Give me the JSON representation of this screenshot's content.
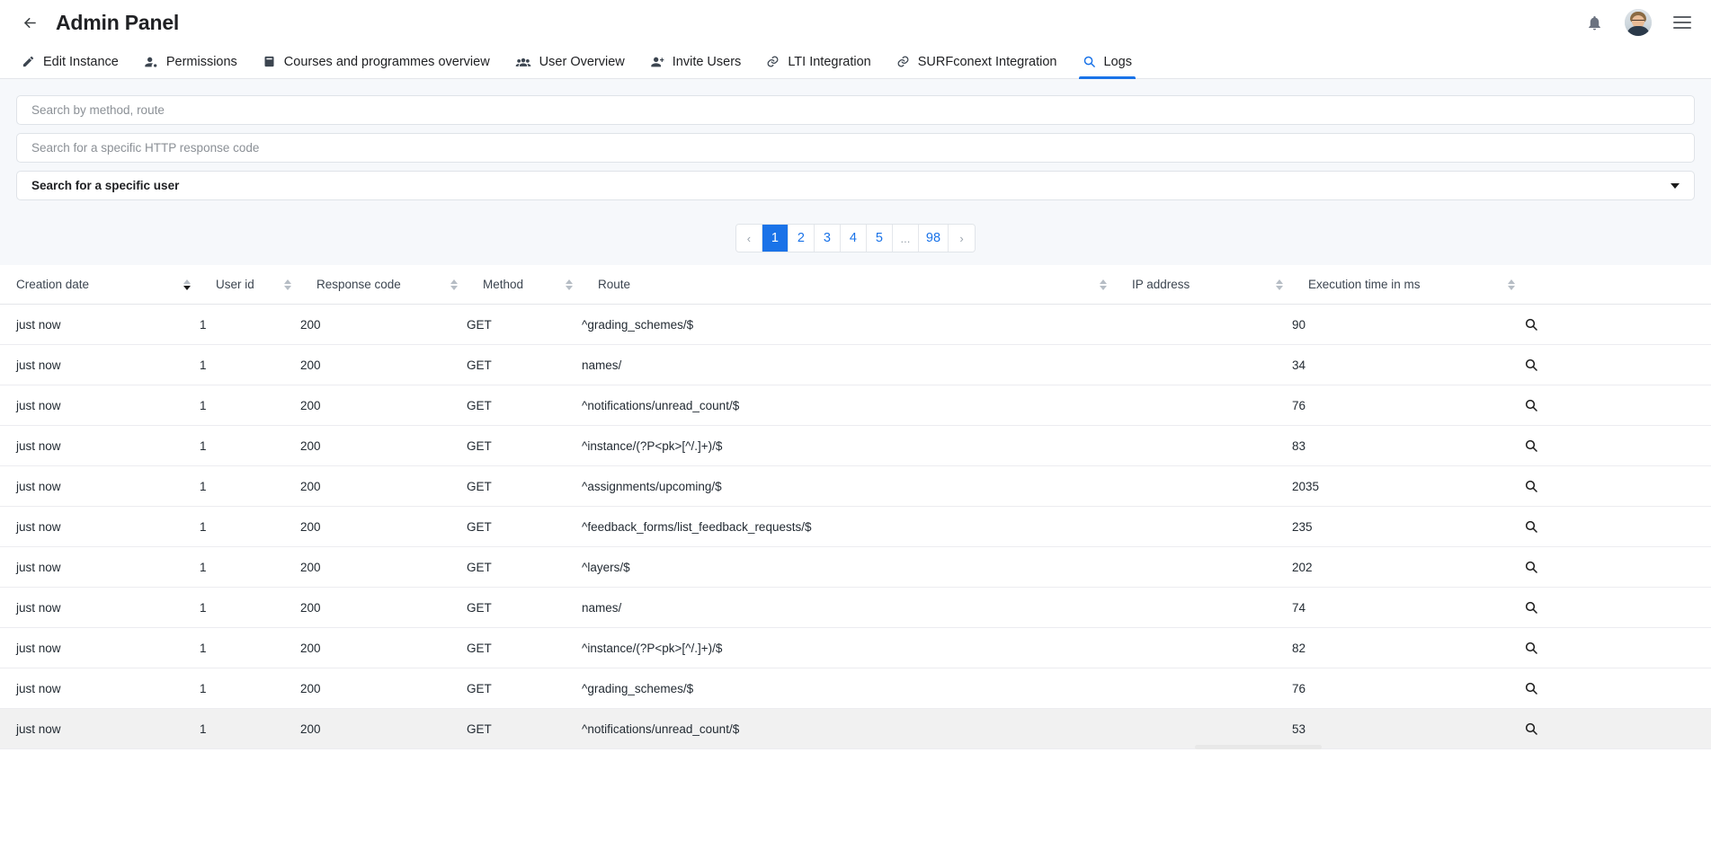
{
  "header": {
    "back_icon": "arrow-left-icon",
    "title": "Admin Panel",
    "notifications_icon": "bell-icon",
    "avatar_label": "user-avatar",
    "menu_icon": "hamburger-menu-icon"
  },
  "tabs": [
    {
      "label": "Edit Instance",
      "icon": "edit-square-icon",
      "active": false
    },
    {
      "label": "Permissions",
      "icon": "person-badge-icon",
      "active": false
    },
    {
      "label": "Courses and programmes overview",
      "icon": "book-icon",
      "active": false
    },
    {
      "label": "User Overview",
      "icon": "people-group-icon",
      "active": false
    },
    {
      "label": "Invite Users",
      "icon": "person-plus-icon",
      "active": false
    },
    {
      "label": "LTI Integration",
      "icon": "link-icon",
      "active": false
    },
    {
      "label": "SURFconext Integration",
      "icon": "link-icon",
      "active": false
    },
    {
      "label": "Logs",
      "icon": "search-icon",
      "active": true
    }
  ],
  "filters": {
    "method_route": {
      "value": "",
      "placeholder": "Search by method, route"
    },
    "response_code": {
      "value": "",
      "placeholder": "Search for a specific HTTP response code"
    },
    "user_select": {
      "value": "Search for a specific user",
      "caret_icon": "chevron-down-icon"
    }
  },
  "pagination": {
    "prev_label": "‹",
    "next_label": "›",
    "ellipsis": "...",
    "pages": [
      "1",
      "2",
      "3",
      "4",
      "5"
    ],
    "last_page": "98",
    "current": "1"
  },
  "table": {
    "columns": [
      {
        "label": "Creation date",
        "sort": "desc"
      },
      {
        "label": "User id",
        "sort": "none"
      },
      {
        "label": "Response code",
        "sort": "none"
      },
      {
        "label": "Method",
        "sort": "none"
      },
      {
        "label": "Route",
        "sort": "none"
      },
      {
        "label": "IP address",
        "sort": "none"
      },
      {
        "label": "Execution time in ms",
        "sort": "none"
      },
      {
        "label": "",
        "sort": "none"
      }
    ],
    "row_action_icon": "magnifier-icon",
    "rows": [
      {
        "creation_date": "just now",
        "user_id": "1",
        "response_code": "200",
        "method": "GET",
        "route": "^grading_schemes/$",
        "ip_address": "",
        "execution_time": "90",
        "hover": false
      },
      {
        "creation_date": "just now",
        "user_id": "1",
        "response_code": "200",
        "method": "GET",
        "route": "names/",
        "ip_address": "",
        "execution_time": "34",
        "hover": false
      },
      {
        "creation_date": "just now",
        "user_id": "1",
        "response_code": "200",
        "method": "GET",
        "route": "^notifications/unread_count/$",
        "ip_address": "",
        "execution_time": "76",
        "hover": false
      },
      {
        "creation_date": "just now",
        "user_id": "1",
        "response_code": "200",
        "method": "GET",
        "route": "^instance/(?P<pk>[^/.]+)/$",
        "ip_address": "",
        "execution_time": "83",
        "hover": false
      },
      {
        "creation_date": "just now",
        "user_id": "1",
        "response_code": "200",
        "method": "GET",
        "route": "^assignments/upcoming/$",
        "ip_address": "",
        "execution_time": "2035",
        "hover": false
      },
      {
        "creation_date": "just now",
        "user_id": "1",
        "response_code": "200",
        "method": "GET",
        "route": "^feedback_forms/list_feedback_requests/$",
        "ip_address": "",
        "execution_time": "235",
        "hover": false
      },
      {
        "creation_date": "just now",
        "user_id": "1",
        "response_code": "200",
        "method": "GET",
        "route": "^layers/$",
        "ip_address": "",
        "execution_time": "202",
        "hover": false
      },
      {
        "creation_date": "just now",
        "user_id": "1",
        "response_code": "200",
        "method": "GET",
        "route": "names/",
        "ip_address": "",
        "execution_time": "74",
        "hover": false
      },
      {
        "creation_date": "just now",
        "user_id": "1",
        "response_code": "200",
        "method": "GET",
        "route": "^instance/(?P<pk>[^/.]+)/$",
        "ip_address": "",
        "execution_time": "82",
        "hover": false
      },
      {
        "creation_date": "just now",
        "user_id": "1",
        "response_code": "200",
        "method": "GET",
        "route": "^grading_schemes/$",
        "ip_address": "",
        "execution_time": "76",
        "hover": false
      },
      {
        "creation_date": "just now",
        "user_id": "1",
        "response_code": "200",
        "method": "GET",
        "route": "^notifications/unread_count/$",
        "ip_address": "",
        "execution_time": "53",
        "hover": true
      }
    ]
  },
  "colors": {
    "accent": "#1a73e8",
    "panel_bg": "#f6f8fb",
    "text": "#202124",
    "muted": "#8b9096",
    "row_hover": "#f1f1f1"
  }
}
